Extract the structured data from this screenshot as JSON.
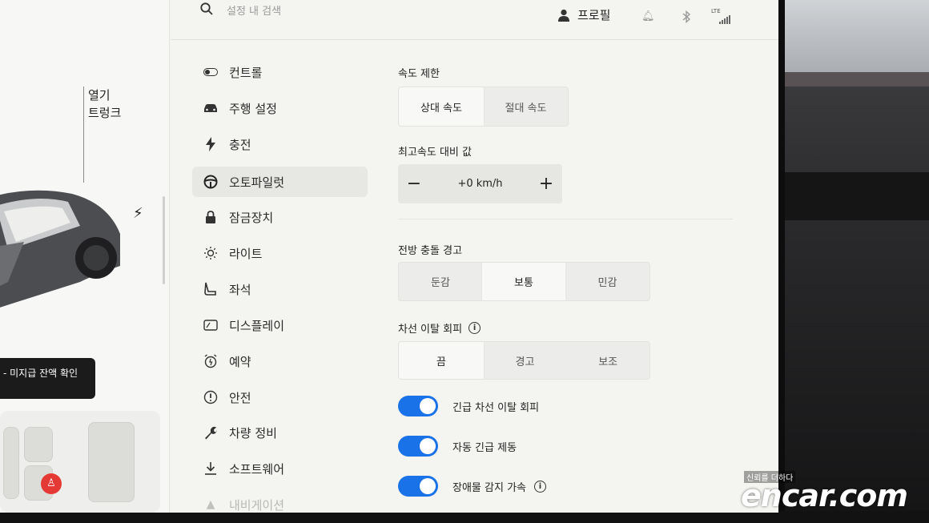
{
  "search": {
    "placeholder": "설정 내 검색"
  },
  "topbar": {
    "profile_label": "프로필",
    "network_label": "LTE"
  },
  "car_panel": {
    "trunk_label_line1": "열기",
    "trunk_label_line2": "트렁크",
    "alert_text": "- 미지급 잔액 확인"
  },
  "nav": {
    "items": [
      {
        "label": "컨트롤",
        "icon": "toggle-icon"
      },
      {
        "label": "주행 설정",
        "icon": "car-icon"
      },
      {
        "label": "충전",
        "icon": "bolt-icon"
      },
      {
        "label": "오토파일럿",
        "icon": "steering-wheel-icon",
        "active": true
      },
      {
        "label": "잠금장치",
        "icon": "lock-icon"
      },
      {
        "label": "라이트",
        "icon": "sun-icon"
      },
      {
        "label": "좌석",
        "icon": "seat-icon"
      },
      {
        "label": "디스플레이",
        "icon": "display-icon"
      },
      {
        "label": "예약",
        "icon": "alarm-clock-icon"
      },
      {
        "label": "안전",
        "icon": "alert-circle-icon"
      },
      {
        "label": "차량 정비",
        "icon": "wrench-icon"
      },
      {
        "label": "소프트웨어",
        "icon": "download-icon"
      },
      {
        "label": "내비게이션",
        "icon": "navigation-icon"
      }
    ]
  },
  "settings": {
    "speed_limit": {
      "label": "속도 제한",
      "options": [
        "상대 속도",
        "절대 속도"
      ],
      "selected": 0
    },
    "offset": {
      "label": "최고속도 대비 값",
      "value": "+0 km/h",
      "minus": "−",
      "plus": "+"
    },
    "forward_collision": {
      "label": "전방 충돌 경고",
      "options": [
        "둔감",
        "보통",
        "민감"
      ],
      "selected": 1
    },
    "lane_departure": {
      "label": "차선 이탈 회피",
      "options": [
        "끔",
        "경고",
        "보조"
      ],
      "selected": 0
    },
    "toggles": [
      {
        "label": "긴급 차선 이탈 회피",
        "on": true
      },
      {
        "label": "자동 긴급 제동",
        "on": true
      },
      {
        "label": "장애물 감지 가속",
        "on": true,
        "info": true
      }
    ]
  },
  "watermark": {
    "tagline": "신뢰를 더하다",
    "logo": "encar.com"
  },
  "colors": {
    "accent": "#1a72e8",
    "screen_bg": "#f4f4f1"
  }
}
